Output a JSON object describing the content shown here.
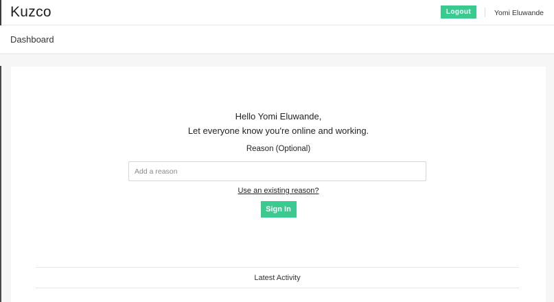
{
  "header": {
    "brand": "Kuzco",
    "logout_label": "Logout",
    "username": "Yomi Eluwande"
  },
  "subheader": {
    "title": "Dashboard"
  },
  "main": {
    "greeting_line1": "Hello Yomi Eluwande,",
    "greeting_line2": "Let everyone know you're online and working.",
    "reason_label": "Reason (Optional)",
    "reason_placeholder": "Add a reason",
    "reason_value": "",
    "existing_reason_link": "Use an existing reason?",
    "signin_label": "Sign In",
    "activity_heading": "Latest Activity"
  },
  "colors": {
    "accent": "#3cc990",
    "background": "#f6f6f6",
    "card": "#ffffff"
  }
}
